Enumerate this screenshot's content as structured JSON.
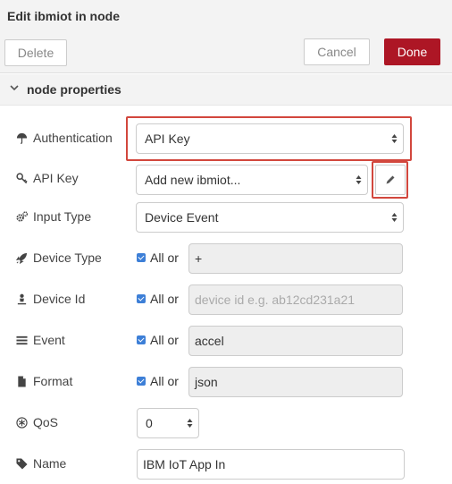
{
  "dialog": {
    "title": "Edit ibmiot in node"
  },
  "toolbar": {
    "delete_label": "Delete",
    "cancel_label": "Cancel",
    "done_label": "Done"
  },
  "section": {
    "title": "node properties"
  },
  "fields": {
    "authentication": {
      "label": "Authentication",
      "value": "API Key"
    },
    "api_key": {
      "label": "API Key",
      "value": "Add new ibmiot..."
    },
    "input_type": {
      "label": "Input Type",
      "value": "Device Event"
    },
    "device_type": {
      "label": "Device Type",
      "all_label": "All or",
      "value": "+"
    },
    "device_id": {
      "label": "Device Id",
      "all_label": "All or",
      "placeholder": "device id e.g. ab12cd231a21"
    },
    "event": {
      "label": "Event",
      "all_label": "All or",
      "value": "accel"
    },
    "format": {
      "label": "Format",
      "all_label": "All or",
      "value": "json"
    },
    "qos": {
      "label": "QoS",
      "value": "0"
    },
    "name": {
      "label": "Name",
      "value": "IBM IoT App In"
    }
  },
  "colors": {
    "done_button": "#ad1625",
    "highlight_border": "#d2473d",
    "checkbox": "#3d7fd7"
  }
}
